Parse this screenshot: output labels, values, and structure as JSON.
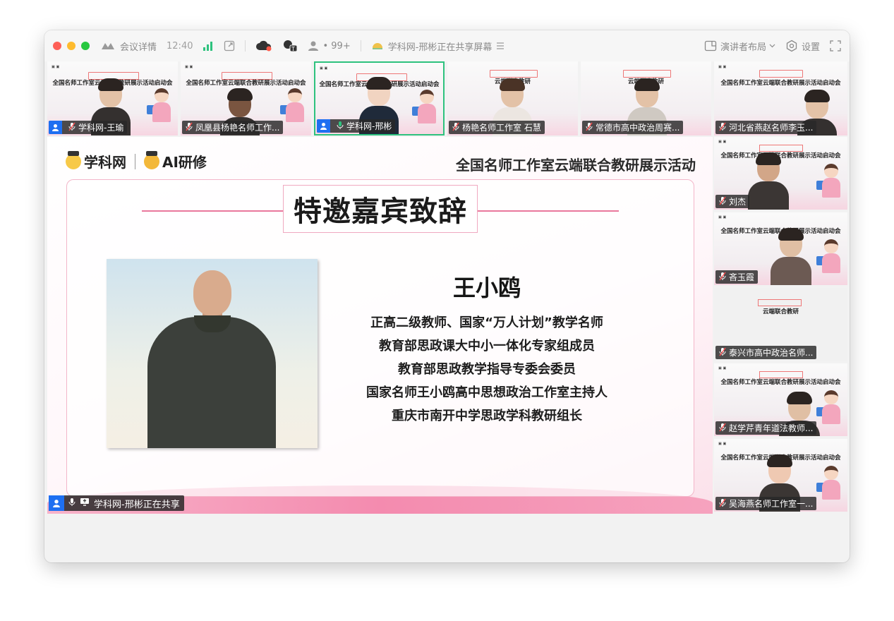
{
  "titlebar": {
    "meeting_details": "会议详情",
    "time": "12:40",
    "participants": "• 99+",
    "sharing_status": "学科网-邢彬正在共享屏幕",
    "layout_label": "演讲者布局",
    "settings_label": "设置"
  },
  "colors": {
    "close": "#fe5f57",
    "minimize": "#febb2e",
    "zoom": "#28c840",
    "signal": "#2ec27e",
    "active_border": "#2ec27e",
    "user_badge": "#1e6ff1",
    "accent_pink": "#e9779c"
  },
  "thumbnails": [
    {
      "name": "学科网-王瑜",
      "title": "全国名师工作室云端联合教研展示活动启动会",
      "speaking": false,
      "has_user_badge": true,
      "active": false
    },
    {
      "name": "凤凰县杨艳名师工作...",
      "title": "全国名师工作室云端联合教研展示活动启动会",
      "speaking": false,
      "has_user_badge": false,
      "active": false
    },
    {
      "name": "学科网-邢彬",
      "title": "全国名师工作室云端联合教研展示活动启动会",
      "speaking": true,
      "has_user_badge": true,
      "active": true
    },
    {
      "name": "杨艳名师工作室 石慧",
      "title": "云端联合教研",
      "speaking": false,
      "has_user_badge": false,
      "active": false
    },
    {
      "name": "常德市高中政治周赛...",
      "title": "云端联合教研",
      "speaking": false,
      "has_user_badge": false,
      "active": false
    },
    {
      "name": "河北省燕赵名师李玉...",
      "title": "全国名师工作室云端联合教研展示活动启动会",
      "speaking": false,
      "has_user_badge": false,
      "active": false
    }
  ],
  "right_tiles": [
    {
      "name": "刘杰",
      "title": "全国名师工作室云端联合教研展示活动启动会"
    },
    {
      "name": "吝玉霞",
      "title": "全国名师工作室云端联合教研展示活动启动会"
    },
    {
      "name": "泰兴市高中政治名师...",
      "title": "云端联合教研"
    },
    {
      "name": "赵学芹青年道法教师...",
      "title": "全国名师工作室云端联合教研展示活动启动会"
    },
    {
      "name": "吴海燕名师工作室一...",
      "title": "全国名师工作室云端联合教研展示活动启动会"
    }
  ],
  "main": {
    "brand_1": "学科网",
    "brand_2": "AI研修",
    "event_title": "全国名师工作室云端联合教研展示活动",
    "heading": "特邀嘉宾致辞",
    "guest_name": "王小鸥",
    "guest_titles": [
      "正高二级教师、国家“万人计划”教学名师",
      "教育部思政课大中小一体化专家组成员",
      "教育部思政教学指导专委会委员",
      "国家名师王小鸥高中思想政治工作室主持人",
      "重庆市南开中学思政学科教研组长"
    ],
    "share_label": "学科网-邢彬正在共享"
  },
  "icons": {
    "meeting": "meeting-logo-icon",
    "signal": "signal-bars-icon",
    "external": "pop-out-icon",
    "cloud": "cloud-record-icon",
    "caption": "caption-translate-icon",
    "participants": "participants-icon",
    "sharer": "share-avatar-icon",
    "menu": "menu-lines-icon",
    "layout": "layout-icon",
    "settings": "gear-icon",
    "fullscreen": "fullscreen-icon",
    "mic": "mic-icon",
    "user": "user-icon"
  }
}
